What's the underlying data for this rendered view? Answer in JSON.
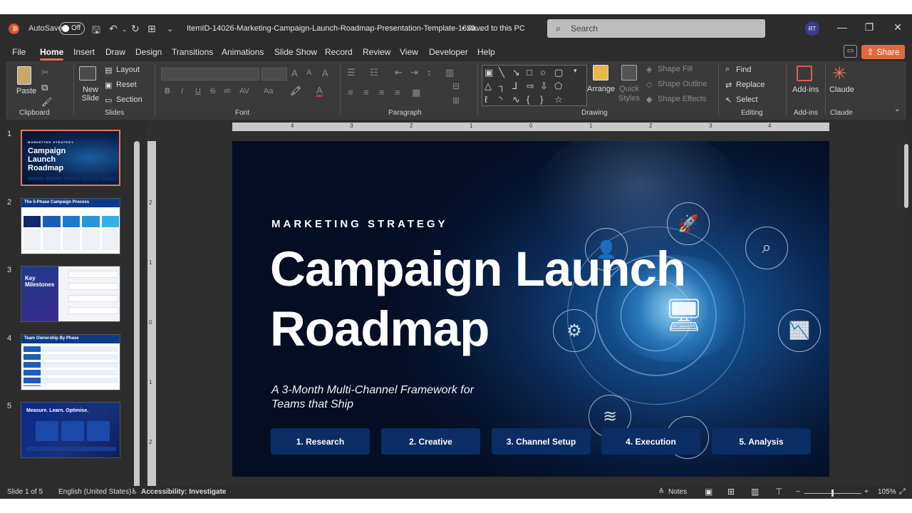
{
  "titlebar": {
    "autosave_label": "AutoSave",
    "autosave_state": "Off",
    "document_title": "ItemID-14026-Marketing-Campaign-Launch-Roadmap-Presentation-Template-16x9....",
    "save_state": "• Saved to this PC",
    "search_placeholder": "Search",
    "user_initials": "RT"
  },
  "menu": {
    "tabs": [
      "File",
      "Home",
      "Insert",
      "Draw",
      "Design",
      "Transitions",
      "Animations",
      "Slide Show",
      "Record",
      "Review",
      "View",
      "Developer",
      "Help"
    ],
    "active": "Home",
    "share_label": "Share"
  },
  "ribbon": {
    "clipboard": {
      "label": "Clipboard",
      "paste": "Paste"
    },
    "slides": {
      "label": "Slides",
      "new_slide": "New Slide",
      "layout": "Layout",
      "reset": "Reset",
      "section": "Section"
    },
    "font": {
      "label": "Font",
      "buttons": [
        "B",
        "I",
        "U",
        "S",
        "ab",
        "AV",
        "Aa"
      ]
    },
    "paragraph": {
      "label": "Paragraph"
    },
    "drawing": {
      "label": "Drawing",
      "arrange": "Arrange",
      "quick_styles": "Quick Styles",
      "shape_fill": "Shape Fill",
      "shape_outline": "Shape Outline",
      "shape_effects": "Shape Effects"
    },
    "editing": {
      "label": "Editing",
      "find": "Find",
      "replace": "Replace",
      "select": "Select"
    },
    "addins": {
      "label": "Add-ins",
      "addins": "Add-ins"
    },
    "claude": {
      "label": "Claude",
      "claude": "Claude"
    }
  },
  "thumbnails": [
    {
      "num": "1",
      "title": "Campaign Launch Roadmap",
      "kicker": "MARKETING STRATEGY"
    },
    {
      "num": "2",
      "title": "The 5-Phase Campaign Process"
    },
    {
      "num": "3",
      "title": "Key Milestones"
    },
    {
      "num": "4",
      "title": "Team Ownership By Phase"
    },
    {
      "num": "5",
      "title": "Measure. Learn. Optimise."
    }
  ],
  "rulers": {
    "horizontal": [
      "4",
      "3",
      "2",
      "1",
      "0",
      "1",
      "2",
      "3",
      "4"
    ],
    "vertical": [
      "2",
      "1",
      "0",
      "1",
      "2"
    ]
  },
  "slide": {
    "kicker": "MARKETING STRATEGY",
    "title_line1": "Campaign Launch",
    "title_line2": "Roadmap",
    "subtitle_line1": "A 3-Month Multi-Channel Framework for",
    "subtitle_line2": "Teams that Ship",
    "phases": [
      "1. Research",
      "2. Creative",
      "3. Channel Setup",
      "4. Execution",
      "5. Analysis"
    ]
  },
  "statusbar": {
    "slide_info": "Slide 1 of 5",
    "language": "English (United States)",
    "accessibility": "Accessibility: Investigate",
    "notes": "Notes",
    "zoom": "105%"
  }
}
